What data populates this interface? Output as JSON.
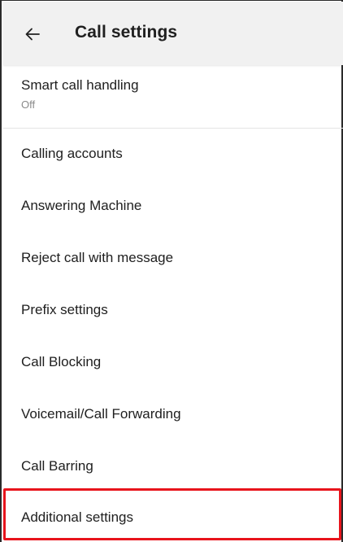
{
  "header": {
    "title": "Call settings",
    "back_icon": "back-arrow-icon"
  },
  "items": [
    {
      "label": "Smart call handling",
      "summary": "Off"
    },
    {
      "label": "Calling accounts"
    },
    {
      "label": "Answering Machine"
    },
    {
      "label": "Reject call with message"
    },
    {
      "label": "Prefix settings"
    },
    {
      "label": "Call Blocking"
    },
    {
      "label": "Voicemail/Call Forwarding"
    },
    {
      "label": "Call Barring"
    },
    {
      "label": "Additional settings"
    }
  ],
  "highlight": {
    "target": "Additional settings",
    "color": "#e8141c"
  },
  "colors": {
    "app_bar": "#f1f1f1",
    "text_primary": "#202020",
    "text_secondary": "#8a8a8a"
  }
}
